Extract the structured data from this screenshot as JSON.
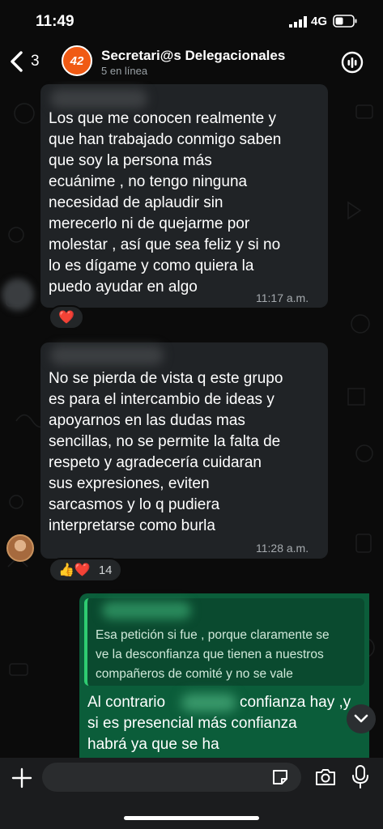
{
  "status_bar": {
    "time": "11:49",
    "network": "4G"
  },
  "header": {
    "back_count": "3",
    "avatar_text": "42",
    "title": "Secretari@s Delegacionales",
    "subtitle": "5 en línea"
  },
  "messages": [
    {
      "text": "Los que me conocen realmente y\nque han trabajado conmigo saben\nque soy la persona más\necuánime , no tengo ninguna\nnecesidad de aplaudir sin\nmerecerlo ni de quejarme por\nmolestar , así que sea feliz y si no\nlo es dígame y como quiera la\npuedo ayudar en algo",
      "time": "11:17 a.m.",
      "reactions": "❤️",
      "reaction_count": ""
    },
    {
      "text": "No se pierda de vista q este grupo\nes para el intercambio de ideas y\napoyarnos en las dudas mas\nsencillas, no se permite la falta de\nrespeto y agradecería cuidaran\nsus expresiones, eviten\nsarcasmos y lo q pudiera\ninterpretarse como burla",
      "time": "11:28 a.m.",
      "reactions": "👍❤️",
      "reaction_count": "14"
    }
  ],
  "outgoing": {
    "quote": "Esa petición si fue , porque claramente se\nve la desconfianza que tienen a nuestros\ncompañeros de comité y no se vale",
    "text_line1_a": "Al contrario",
    "text_line1_b": "confianza hay ,y",
    "text_rest": "si es presencial más confianza\nhabrá ya que se ha"
  },
  "input": {
    "placeholder": ""
  },
  "colors": {
    "background": "#0b0b0b",
    "incoming_bubble": "#202326",
    "outgoing_bubble": "#0b5d3a",
    "quote_accent": "#2ecc71",
    "avatar_brand": "#f05a14"
  },
  "icons": [
    "chevron-left-icon",
    "signal-icon",
    "battery-icon",
    "call-add-icon",
    "plus-icon",
    "sticker-icon",
    "camera-icon",
    "mic-icon",
    "chevron-down-icon"
  ]
}
